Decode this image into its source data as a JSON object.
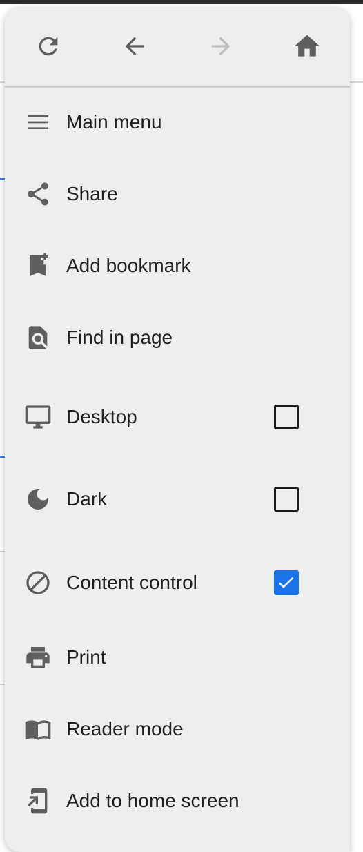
{
  "toolbar": {
    "reload_icon": "reload-icon",
    "back_icon": "arrow-back-icon",
    "forward_icon": "arrow-forward-icon",
    "home_icon": "home-icon",
    "forward_enabled": false
  },
  "menu": {
    "items": [
      {
        "label": "Main menu",
        "icon": "hamburger-menu-icon"
      },
      {
        "label": "Share",
        "icon": "share-icon"
      },
      {
        "label": "Add bookmark",
        "icon": "bookmark-add-icon"
      },
      {
        "label": "Find in page",
        "icon": "find-in-page-icon"
      },
      {
        "label": "Desktop",
        "icon": "desktop-icon",
        "checked": false
      },
      {
        "label": "Dark",
        "icon": "moon-icon",
        "checked": false
      },
      {
        "label": "Content control",
        "icon": "block-icon",
        "checked": true
      },
      {
        "label": "Print",
        "icon": "print-icon"
      },
      {
        "label": "Reader mode",
        "icon": "book-open-icon"
      },
      {
        "label": "Add to home screen",
        "icon": "add-to-home-icon"
      }
    ]
  },
  "colors": {
    "menu_bg": "#eeeeee",
    "icon": "#5f5f5f",
    "icon_disabled": "#bdbdbd",
    "checkbox_checked": "#1a73e8",
    "text": "#202020"
  }
}
